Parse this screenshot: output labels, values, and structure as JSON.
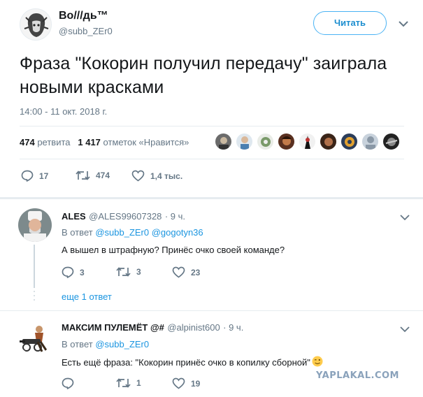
{
  "main_tweet": {
    "author_name": "Во///дь™",
    "author_handle": "@subb_ZEr0",
    "follow_label": "Читать",
    "text": "Фраза \"Кокорин получил передачу\" заиграла новыми красками",
    "timestamp": "14:00 - 11 окт. 2018 г.",
    "retweets_count": "474",
    "retweets_label": "ретвита",
    "likes_count": "1 417",
    "likes_label": "отметок «Нравится»",
    "actions": {
      "replies": "17",
      "retweets": "474",
      "likes": "1,4 тыс."
    }
  },
  "replies": [
    {
      "name": "ALES",
      "handle": "@ALES99607328",
      "time": "· 9 ч.",
      "in_reply_prefix": "В ответ",
      "in_reply_to": "@subb_ZEr0 @gogotyn36",
      "text": "А вышел в штрафную? Принёс очко своей команде?",
      "actions": {
        "replies": "3",
        "retweets": "3",
        "likes": "23"
      },
      "more_label": "еще 1 ответ"
    },
    {
      "name": "МАКСИМ ПУЛЕМЁТ @#",
      "handle": "@alpinist600",
      "time": "· 9 ч.",
      "in_reply_prefix": "В ответ",
      "in_reply_to": "@subb_ZEr0",
      "text": "Есть ещё фраза: \"Кокорин принёс очко в копилку сборной\"",
      "actions": {
        "replies": "",
        "retweets": "1",
        "likes": "19"
      }
    }
  ],
  "watermark": "YAPLAKAL.COM",
  "colors": {
    "link": "#1b95e0",
    "muted": "#657786",
    "follow_border": "#4ab3f4"
  },
  "icons": [
    "chevron-down-icon",
    "reply-icon",
    "retweet-icon",
    "like-icon",
    "wink-emoji-icon"
  ]
}
